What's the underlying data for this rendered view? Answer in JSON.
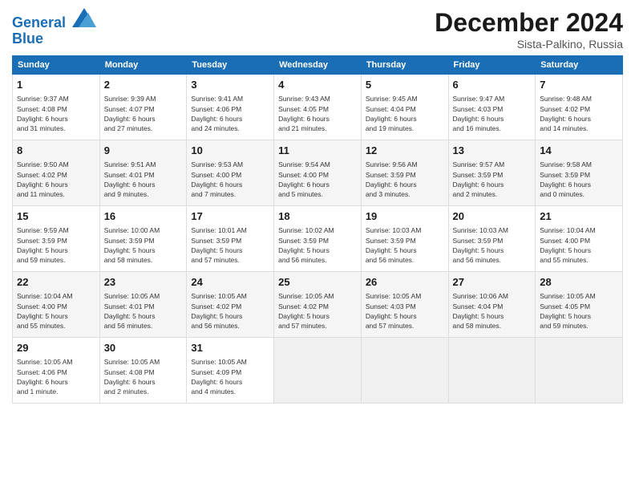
{
  "header": {
    "logo_line1": "General",
    "logo_line2": "Blue",
    "month": "December 2024",
    "location": "Sista-Palkino, Russia"
  },
  "weekdays": [
    "Sunday",
    "Monday",
    "Tuesday",
    "Wednesday",
    "Thursday",
    "Friday",
    "Saturday"
  ],
  "weeks": [
    [
      {
        "day": "1",
        "info": "Sunrise: 9:37 AM\nSunset: 4:08 PM\nDaylight: 6 hours\nand 31 minutes."
      },
      {
        "day": "2",
        "info": "Sunrise: 9:39 AM\nSunset: 4:07 PM\nDaylight: 6 hours\nand 27 minutes."
      },
      {
        "day": "3",
        "info": "Sunrise: 9:41 AM\nSunset: 4:06 PM\nDaylight: 6 hours\nand 24 minutes."
      },
      {
        "day": "4",
        "info": "Sunrise: 9:43 AM\nSunset: 4:05 PM\nDaylight: 6 hours\nand 21 minutes."
      },
      {
        "day": "5",
        "info": "Sunrise: 9:45 AM\nSunset: 4:04 PM\nDaylight: 6 hours\nand 19 minutes."
      },
      {
        "day": "6",
        "info": "Sunrise: 9:47 AM\nSunset: 4:03 PM\nDaylight: 6 hours\nand 16 minutes."
      },
      {
        "day": "7",
        "info": "Sunrise: 9:48 AM\nSunset: 4:02 PM\nDaylight: 6 hours\nand 14 minutes."
      }
    ],
    [
      {
        "day": "8",
        "info": "Sunrise: 9:50 AM\nSunset: 4:02 PM\nDaylight: 6 hours\nand 11 minutes."
      },
      {
        "day": "9",
        "info": "Sunrise: 9:51 AM\nSunset: 4:01 PM\nDaylight: 6 hours\nand 9 minutes."
      },
      {
        "day": "10",
        "info": "Sunrise: 9:53 AM\nSunset: 4:00 PM\nDaylight: 6 hours\nand 7 minutes."
      },
      {
        "day": "11",
        "info": "Sunrise: 9:54 AM\nSunset: 4:00 PM\nDaylight: 6 hours\nand 5 minutes."
      },
      {
        "day": "12",
        "info": "Sunrise: 9:56 AM\nSunset: 3:59 PM\nDaylight: 6 hours\nand 3 minutes."
      },
      {
        "day": "13",
        "info": "Sunrise: 9:57 AM\nSunset: 3:59 PM\nDaylight: 6 hours\nand 2 minutes."
      },
      {
        "day": "14",
        "info": "Sunrise: 9:58 AM\nSunset: 3:59 PM\nDaylight: 6 hours\nand 0 minutes."
      }
    ],
    [
      {
        "day": "15",
        "info": "Sunrise: 9:59 AM\nSunset: 3:59 PM\nDaylight: 5 hours\nand 59 minutes."
      },
      {
        "day": "16",
        "info": "Sunrise: 10:00 AM\nSunset: 3:59 PM\nDaylight: 5 hours\nand 58 minutes."
      },
      {
        "day": "17",
        "info": "Sunrise: 10:01 AM\nSunset: 3:59 PM\nDaylight: 5 hours\nand 57 minutes."
      },
      {
        "day": "18",
        "info": "Sunrise: 10:02 AM\nSunset: 3:59 PM\nDaylight: 5 hours\nand 56 minutes."
      },
      {
        "day": "19",
        "info": "Sunrise: 10:03 AM\nSunset: 3:59 PM\nDaylight: 5 hours\nand 56 minutes."
      },
      {
        "day": "20",
        "info": "Sunrise: 10:03 AM\nSunset: 3:59 PM\nDaylight: 5 hours\nand 56 minutes."
      },
      {
        "day": "21",
        "info": "Sunrise: 10:04 AM\nSunset: 4:00 PM\nDaylight: 5 hours\nand 55 minutes."
      }
    ],
    [
      {
        "day": "22",
        "info": "Sunrise: 10:04 AM\nSunset: 4:00 PM\nDaylight: 5 hours\nand 55 minutes."
      },
      {
        "day": "23",
        "info": "Sunrise: 10:05 AM\nSunset: 4:01 PM\nDaylight: 5 hours\nand 56 minutes."
      },
      {
        "day": "24",
        "info": "Sunrise: 10:05 AM\nSunset: 4:02 PM\nDaylight: 5 hours\nand 56 minutes."
      },
      {
        "day": "25",
        "info": "Sunrise: 10:05 AM\nSunset: 4:02 PM\nDaylight: 5 hours\nand 57 minutes."
      },
      {
        "day": "26",
        "info": "Sunrise: 10:05 AM\nSunset: 4:03 PM\nDaylight: 5 hours\nand 57 minutes."
      },
      {
        "day": "27",
        "info": "Sunrise: 10:06 AM\nSunset: 4:04 PM\nDaylight: 5 hours\nand 58 minutes."
      },
      {
        "day": "28",
        "info": "Sunrise: 10:05 AM\nSunset: 4:05 PM\nDaylight: 5 hours\nand 59 minutes."
      }
    ],
    [
      {
        "day": "29",
        "info": "Sunrise: 10:05 AM\nSunset: 4:06 PM\nDaylight: 6 hours\nand 1 minute."
      },
      {
        "day": "30",
        "info": "Sunrise: 10:05 AM\nSunset: 4:08 PM\nDaylight: 6 hours\nand 2 minutes."
      },
      {
        "day": "31",
        "info": "Sunrise: 10:05 AM\nSunset: 4:09 PM\nDaylight: 6 hours\nand 4 minutes."
      },
      {
        "day": "",
        "info": ""
      },
      {
        "day": "",
        "info": ""
      },
      {
        "day": "",
        "info": ""
      },
      {
        "day": "",
        "info": ""
      }
    ]
  ]
}
